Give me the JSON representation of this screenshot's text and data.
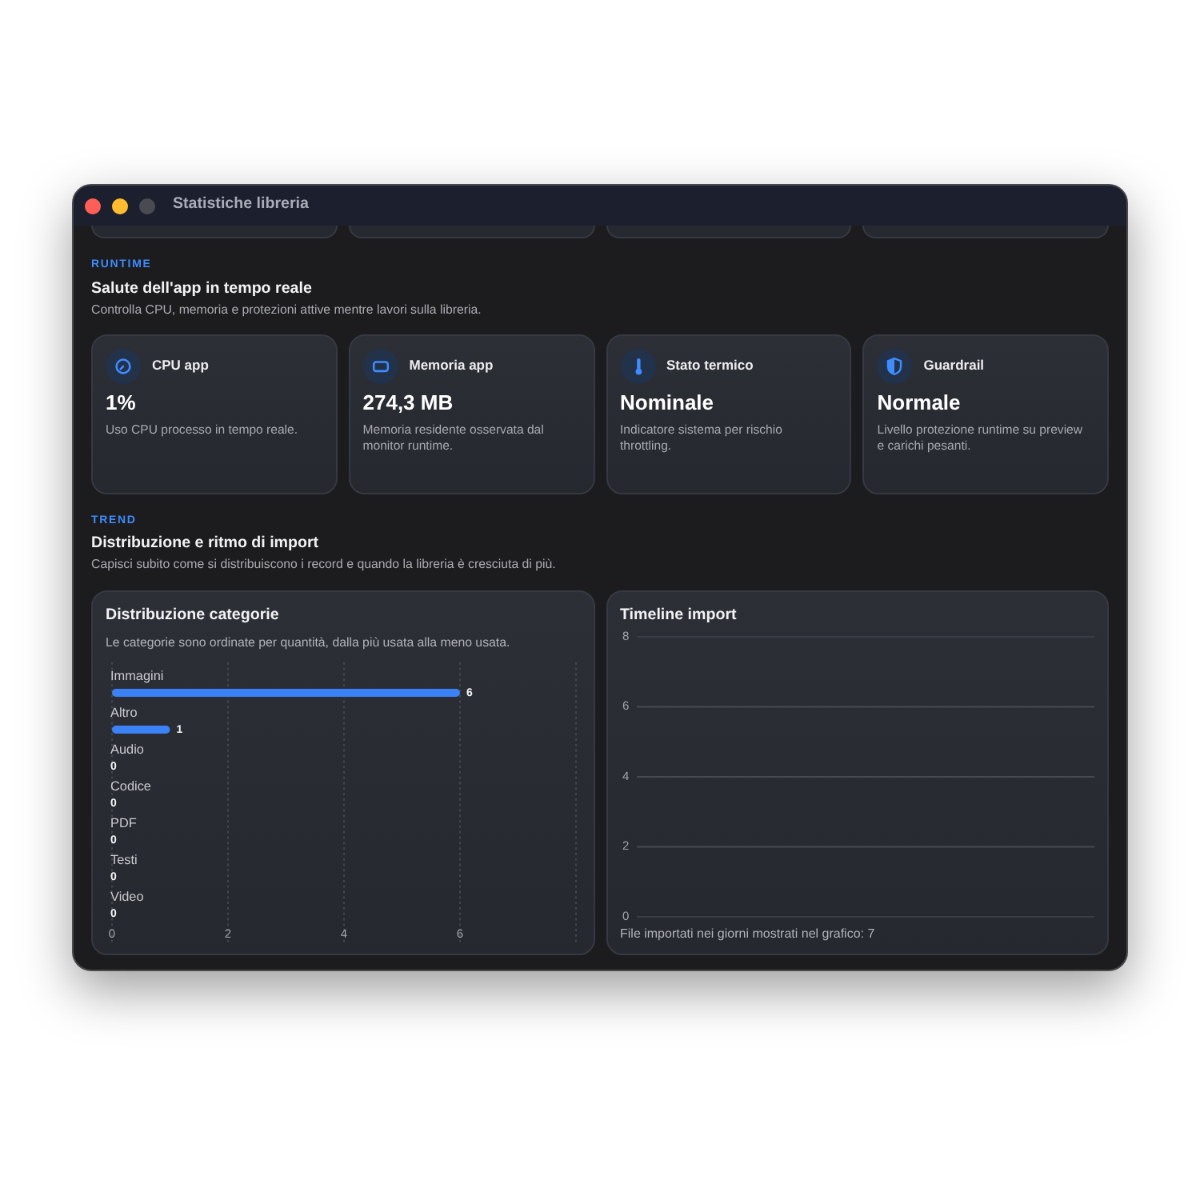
{
  "window": {
    "title": "Statistiche libreria",
    "buttons": [
      {
        "kind": "close",
        "disabled": false
      },
      {
        "kind": "minimize",
        "disabled": false
      },
      {
        "kind": "zoom",
        "disabled": true
      }
    ]
  },
  "runtime": {
    "eyebrow": "RUNTIME",
    "title": "Salute dell'app in tempo reale",
    "description": "Controlla CPU, memoria e protezioni attive mentre lavori sulla libreria.",
    "cards": [
      {
        "kind": "cpu",
        "title": "CPU app",
        "value": "1%",
        "description": "Uso CPU processo in tempo reale."
      },
      {
        "kind": "memory",
        "title": "Memoria app",
        "value": "274,3 MB",
        "description": "Memoria residente osservata dal monitor runtime."
      },
      {
        "kind": "thermal",
        "title": "Stato termico",
        "value": "Nominale",
        "description": "Indicatore sistema per rischio throttling."
      },
      {
        "kind": "guard",
        "title": "Guardrail",
        "value": "Normale",
        "description": "Livello protezione runtime su preview e carichi pesanti."
      }
    ]
  },
  "trend": {
    "eyebrow": "TREND",
    "title": "Distribuzione e ritmo di import",
    "description": "Capisci subito come si distribuiscono i record e quando la libreria è cresciuta di più.",
    "category_panel": {
      "description": "Le categorie sono ordinate per quantità, dalla più usata alla meno usata.",
      "chart_data": {
        "type": "bar",
        "title": "Distribuzione categorie",
        "orientation": "horizontal",
        "categories": [
          "Immagini",
          "Altro",
          "Audio",
          "Codice",
          "PDF",
          "Testi",
          "Video"
        ],
        "series": [
          {
            "color": "#3b82f6",
            "values": [
              6,
              1,
              0,
              0,
              0,
              0,
              0
            ]
          }
        ],
        "xlim": [
          0,
          8
        ],
        "xticks": [
          0,
          2,
          4,
          6
        ],
        "grid": true,
        "data_labels": true
      }
    },
    "timeline_panel": {
      "title": "Timeline import",
      "axis_labels": [
        "8",
        "6",
        "4",
        "2",
        "0"
      ],
      "footer": "File importati nei giorni mostrati nel grafico: 7"
    }
  }
}
